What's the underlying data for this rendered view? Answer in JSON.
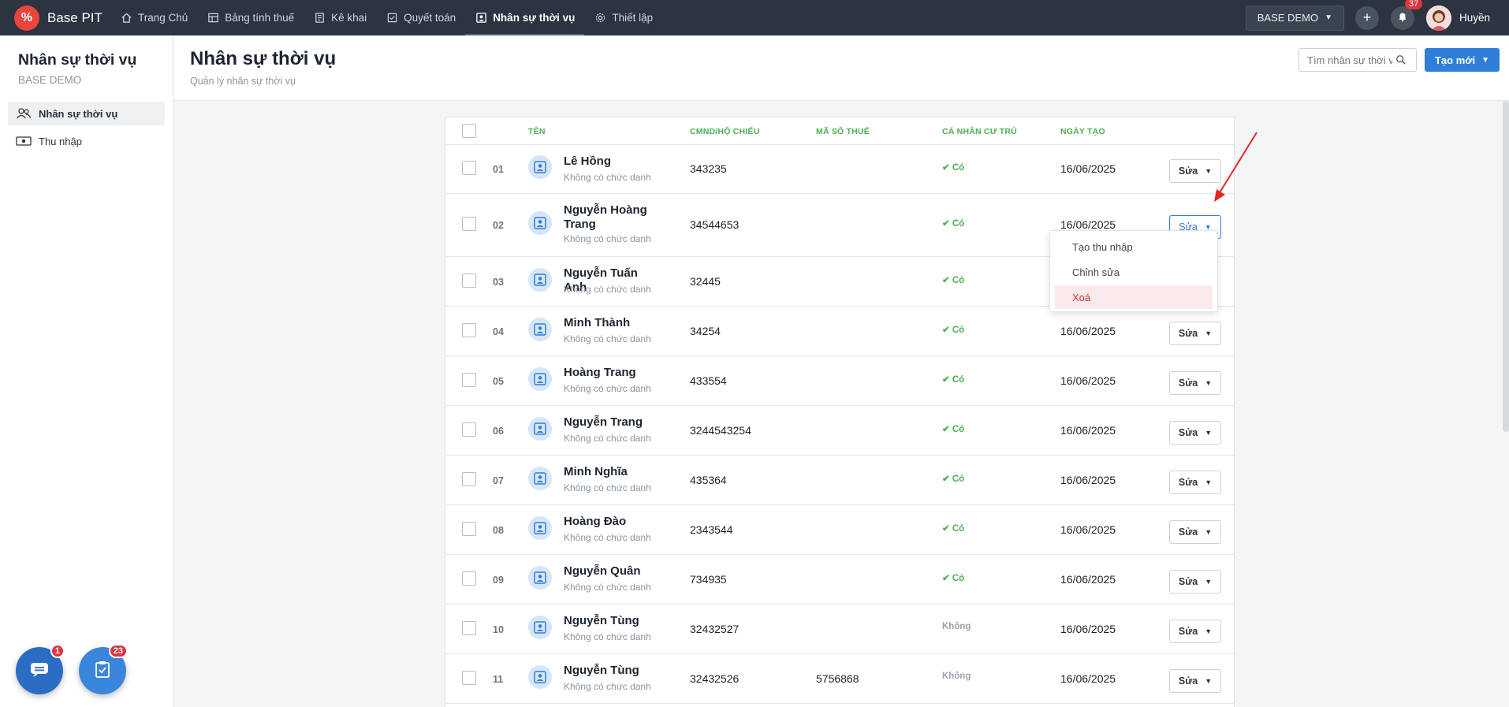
{
  "nav": {
    "brand": "Base PIT",
    "brand_logo": "%",
    "items": [
      {
        "label": "Trang Chủ",
        "icon": "home-icon"
      },
      {
        "label": "Bảng tính thuế",
        "icon": "table-icon"
      },
      {
        "label": "Kê khai",
        "icon": "document-icon"
      },
      {
        "label": "Quyết toán",
        "icon": "checklist-icon"
      },
      {
        "label": "Nhân sự thời vụ",
        "icon": "person-card-icon",
        "active": true
      },
      {
        "label": "Thiết lập",
        "icon": "gear-icon"
      }
    ],
    "company": "BASE DEMO",
    "notifications": "37",
    "user": "Huyền"
  },
  "sidebar": {
    "title": "Nhân sự thời vụ",
    "subtitle": "BASE DEMO",
    "items": [
      {
        "label": "Nhân sự thời vụ",
        "icon": "people-icon",
        "active": true
      },
      {
        "label": "Thu nhập",
        "icon": "money-icon"
      }
    ]
  },
  "header": {
    "title": "Nhân sự thời vụ",
    "subtitle": "Quản lý nhân sự thời vụ",
    "search_placeholder": "Tìm nhân sự thời vụ",
    "create_label": "Tạo mới"
  },
  "table": {
    "columns": [
      "TÊN",
      "CMND/HỘ CHIẾU",
      "MÃ SỐ THUẾ",
      "CÁ NHÂN CƯ TRÚ",
      "NGÀY TẠO"
    ],
    "edit_label": "Sửa",
    "rows": [
      {
        "no": "01",
        "name": "Lê Hồng",
        "position": "Không có chức danh",
        "id_number": "343235",
        "tax_code": "",
        "resident": "Có",
        "created": "16/06/2025"
      },
      {
        "no": "02",
        "name": "Nguyễn Hoàng Trang",
        "position": "Không có chức danh",
        "id_number": "34544653",
        "tax_code": "",
        "resident": "Có",
        "created": "16/06/2025"
      },
      {
        "no": "03",
        "name": "Nguyễn Tuấn Anh",
        "position": "Không có chức danh",
        "id_number": "32445",
        "tax_code": "",
        "resident": "Có",
        "created": ""
      },
      {
        "no": "04",
        "name": "Minh Thành",
        "position": "Không có chức danh",
        "id_number": "34254",
        "tax_code": "",
        "resident": "Có",
        "created": "16/06/2025"
      },
      {
        "no": "05",
        "name": "Hoàng Trang",
        "position": "Không có chức danh",
        "id_number": "433554",
        "tax_code": "",
        "resident": "Có",
        "created": "16/06/2025"
      },
      {
        "no": "06",
        "name": "Nguyễn Trang",
        "position": "Không có chức danh",
        "id_number": "3244543254",
        "tax_code": "",
        "resident": "Có",
        "created": "16/06/2025"
      },
      {
        "no": "07",
        "name": "Minh Nghĩa",
        "position": "Không có chức danh",
        "id_number": "435364",
        "tax_code": "",
        "resident": "Có",
        "created": "16/06/2025"
      },
      {
        "no": "08",
        "name": "Hoàng Đào",
        "position": "Không có chức danh",
        "id_number": "2343544",
        "tax_code": "",
        "resident": "Có",
        "created": "16/06/2025"
      },
      {
        "no": "09",
        "name": "Nguyễn Quân",
        "position": "Không có chức danh",
        "id_number": "734935",
        "tax_code": "",
        "resident": "Có",
        "created": "16/06/2025"
      },
      {
        "no": "10",
        "name": "Nguyễn Tùng",
        "position": "Không có chức danh",
        "id_number": "32432527",
        "tax_code": "",
        "resident": "Không",
        "created": "16/06/2025"
      },
      {
        "no": "11",
        "name": "Nguyễn Tùng",
        "position": "Không có chức danh",
        "id_number": "32432526",
        "tax_code": "5756868",
        "resident": "Không",
        "created": "16/06/2025"
      }
    ]
  },
  "dropdown": {
    "items": [
      "Tạo thu nhập",
      "Chỉnh sửa",
      "Xoá"
    ]
  },
  "fabs": {
    "chat_badge": "1",
    "tasks_badge": "23"
  },
  "colors": {
    "nav_bg": "#2b3440",
    "accent": "#2f7fd8",
    "green": "#4caf50",
    "danger": "#c9303a",
    "arrow": "#e8251f"
  }
}
